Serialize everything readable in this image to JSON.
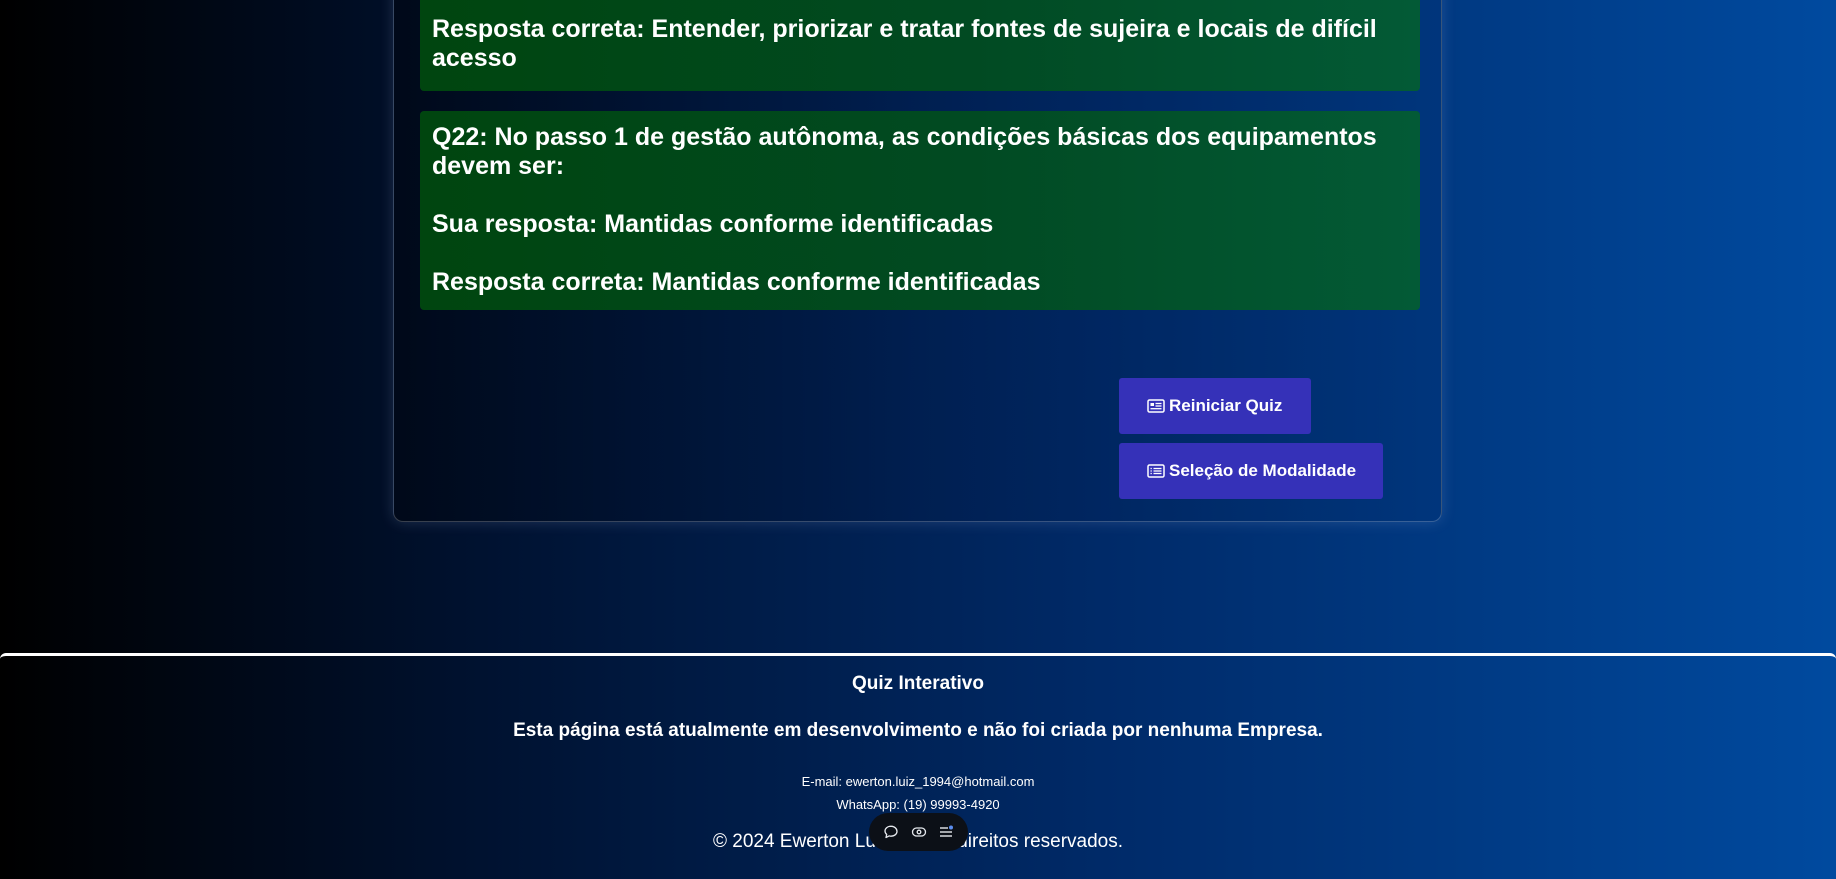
{
  "results": [
    {
      "question": "",
      "your_answer": "",
      "correct_answer": "Resposta correta: Entender, priorizar e tratar fontes de sujeira e locais de difícil acesso"
    },
    {
      "question": "Q22: No passo 1 de gestão autônoma, as condições básicas dos equipamentos devem ser:",
      "your_answer": "Sua resposta: Mantidas conforme identificadas",
      "correct_answer": "Resposta correta: Mantidas conforme identificadas"
    }
  ],
  "actions": {
    "restart_label": "Reiniciar Quiz",
    "restart_icon": "id-card-icon",
    "mode_label": "Seleção de Modalidade",
    "mode_icon": "list-icon"
  },
  "footer": {
    "title": "Quiz Interativo",
    "notice": "Esta página está atualmente em desenvolvimento e não foi criada por nenhuma Empresa.",
    "email": "E-mail: ewerton.luiz_1994@hotmail.com",
    "whatsapp": "WhatsApp: (19) 99993-4920",
    "copyright": "© 2024 Ewerton Luiz e ... os direitos reservados."
  },
  "toolbar": {
    "icons": [
      "chat-icon",
      "eye-icon",
      "menu-list-icon"
    ]
  },
  "colors": {
    "correct_block": "#014a22",
    "button": "#3531b8",
    "background_start": "#000000",
    "background_end": "#004a9f"
  }
}
